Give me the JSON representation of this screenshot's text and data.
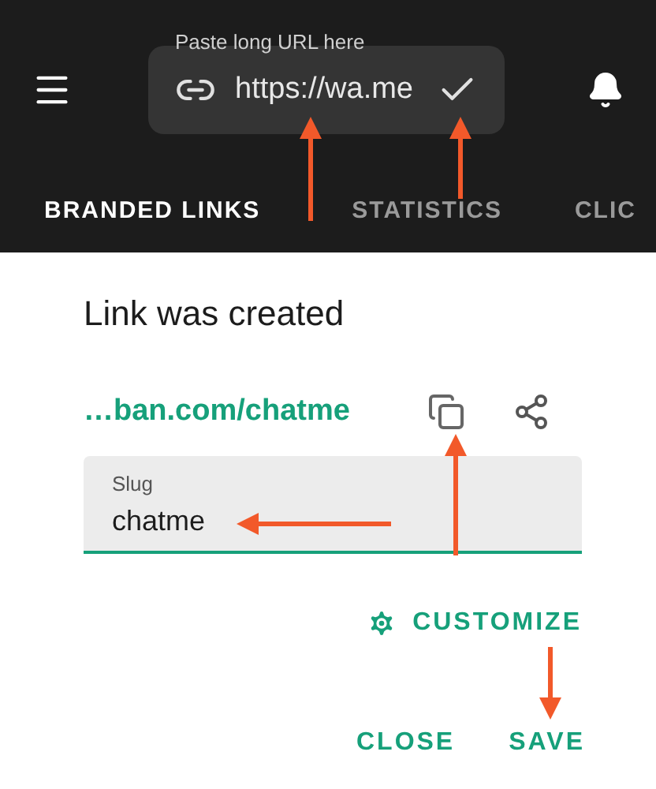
{
  "url_field": {
    "label": "Paste long URL here",
    "value": "https://wa.me"
  },
  "tabs": [
    {
      "label": "BRANDED LINKS",
      "selected": true
    },
    {
      "label": "STATISTICS",
      "selected": false
    },
    {
      "label": "CLIC",
      "selected": false
    }
  ],
  "dialog": {
    "title": "Link was created",
    "short_link": "…ban.com/chatme",
    "slug_field": {
      "label": "Slug",
      "value": "chatme"
    },
    "customize": "CUSTOMIZE",
    "buttons": [
      "CLOSE",
      "SAVE"
    ]
  }
}
